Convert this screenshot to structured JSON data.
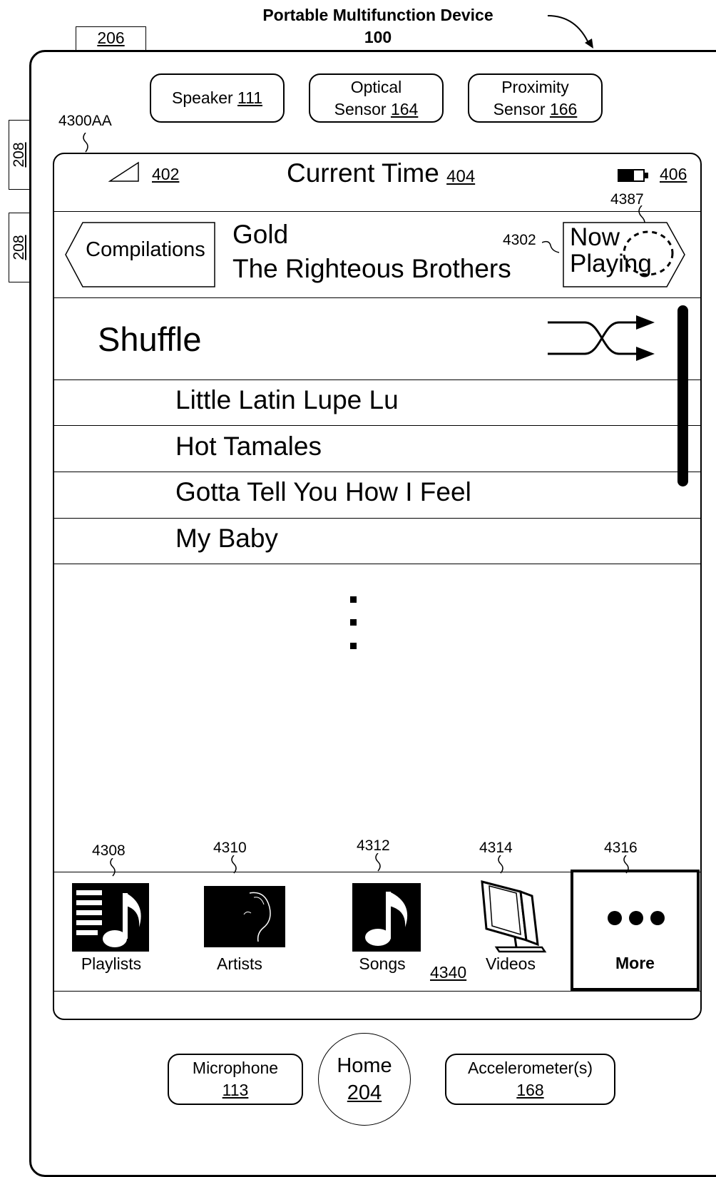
{
  "title": {
    "line1": "Portable Multifunction Device",
    "line2": "100"
  },
  "refs": {
    "tab_206": "206",
    "side_208_a": "208",
    "side_208_b": "208",
    "screen": "4300AA",
    "signal": "402",
    "battery": "406",
    "now_playing": "4387",
    "now_playing_button": "4302",
    "tab_playlists": "4308",
    "tab_artists": "4310",
    "tab_songs": "4312",
    "tab_videos": "4314",
    "tab_more": "4316",
    "tab_bar": "4340"
  },
  "hardware": {
    "speaker": {
      "label": "Speaker",
      "num": "111"
    },
    "optical": {
      "line1": "Optical",
      "line2": "Sensor",
      "num": "164"
    },
    "proximity": {
      "line1": "Proximity",
      "line2": "Sensor",
      "num": "166"
    },
    "microphone": {
      "label": "Microphone",
      "num": "113"
    },
    "home": {
      "label": "Home",
      "num": "204"
    },
    "accelerometer": {
      "label": "Accelerometer(s)",
      "num": "168"
    }
  },
  "status_bar": {
    "time_label": "Current Time",
    "time_num": "404"
  },
  "nav": {
    "back_label": "Compilations",
    "album": "Gold",
    "artist": "The Righteous Brothers",
    "now_playing_line1": "Now",
    "now_playing_line2": "Playing"
  },
  "list": {
    "shuffle_label": "Shuffle",
    "songs": [
      "Little Latin Lupe Lu",
      "Hot Tamales",
      "Gotta Tell You How I Feel",
      "My Baby"
    ]
  },
  "tabs": {
    "playlists": "Playlists",
    "artists": "Artists",
    "songs": "Songs",
    "videos": "Videos",
    "more": "More"
  },
  "icons": {
    "signal": "signal-strength-icon",
    "battery": "battery-icon",
    "shuffle": "shuffle-icon",
    "playlists": "playlist-icon",
    "artists": "artist-icon",
    "songs": "music-note-icon",
    "videos": "tv-icon",
    "more": "ellipsis-icon"
  }
}
